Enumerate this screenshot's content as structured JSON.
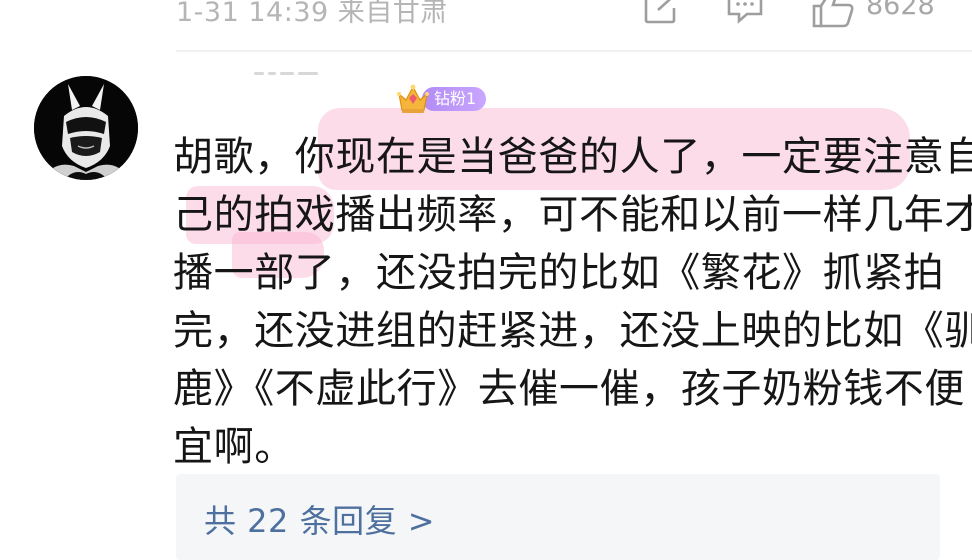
{
  "meta": {
    "timestamp": "1-31 14:39",
    "location": "来自甘肃",
    "like_count": "8628"
  },
  "icons": {
    "share": "share-icon",
    "comment": "comment-icon",
    "like": "thumbs-up-icon",
    "badge": "crown-icon"
  },
  "badge": {
    "label": "钻粉1"
  },
  "comment": {
    "lines": [
      "胡歌，你现在是当爸爸的人了，一定要注意自",
      "己的拍戏播出频率，可不能和以前一样几年才",
      "播一部了，还没拍完的比如《繁花》抓紧拍",
      "完，还没进组的赶紧进，还没上映的比如《驯",
      "鹿》《不虚此行》去催一催，孩子奶粉钱不便",
      "宜啊。"
    ]
  },
  "replies": {
    "label": "共 22 条回复 >"
  },
  "colors": {
    "highlight": "#faaccd",
    "badge": "#b28bf5",
    "reply_link": "#4e709e",
    "reply_bg": "#f5f6f8"
  }
}
